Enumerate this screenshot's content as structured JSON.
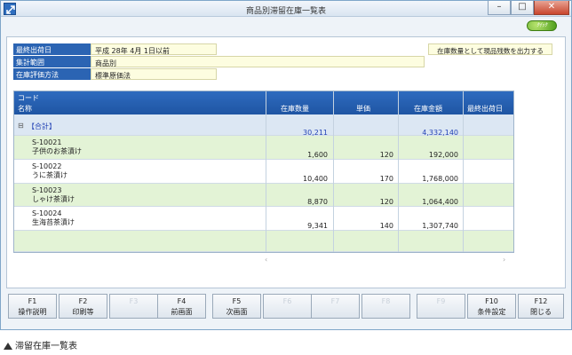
{
  "window": {
    "title": "商品別滞留在庫一覧表"
  },
  "quick_label": "ｸｲｯｸ",
  "info": {
    "fields": [
      {
        "label": "最終出荷日",
        "value": "平成 28年 4月 1日以前"
      },
      {
        "label": "集計範囲",
        "value": "商品別"
      },
      {
        "label": "在庫評価方法",
        "value": "標準原価法"
      }
    ],
    "note": "在庫数量として現品残数を出力する"
  },
  "table": {
    "header": {
      "code": "コード",
      "name": "名称",
      "qty": "在庫数量",
      "price": "単価",
      "amount": "在庫金額",
      "last_ship": "最終出荷日"
    },
    "total": {
      "toggle": "⊟",
      "label": "【合計】",
      "qty": "30,211",
      "amount": "4,332,140"
    },
    "rows": [
      {
        "code": "S-10021",
        "name": "子供のお茶漬け",
        "qty": "1,600",
        "price": "120",
        "amount": "192,000"
      },
      {
        "code": "S-10022",
        "name": "うに茶漬け",
        "qty": "10,400",
        "price": "170",
        "amount": "1,768,000"
      },
      {
        "code": "S-10023",
        "name": "しゃけ茶漬け",
        "qty": "8,870",
        "price": "120",
        "amount": "1,064,400"
      },
      {
        "code": "S-10024",
        "name": "生海苔茶漬け",
        "qty": "9,341",
        "price": "140",
        "amount": "1,307,740"
      }
    ]
  },
  "fkeys": [
    {
      "key": "F1",
      "label": "操作説明",
      "enabled": true
    },
    {
      "key": "F2",
      "label": "印刷等",
      "enabled": true
    },
    {
      "key": "F3",
      "label": "",
      "enabled": false
    },
    {
      "key": "F4",
      "label": "前画面",
      "enabled": true
    },
    {
      "key": "F5",
      "label": "次画面",
      "enabled": true
    },
    {
      "key": "F6",
      "label": "",
      "enabled": false
    },
    {
      "key": "F7",
      "label": "",
      "enabled": false
    },
    {
      "key": "F8",
      "label": "",
      "enabled": false
    },
    {
      "key": "F9",
      "label": "",
      "enabled": false
    },
    {
      "key": "F10",
      "label": "条件設定",
      "enabled": true
    },
    {
      "key": "F11",
      "label": "",
      "enabled": false
    },
    {
      "key": "F12",
      "label": "閉じる",
      "enabled": true
    }
  ],
  "caption": "滞留在庫一覧表"
}
